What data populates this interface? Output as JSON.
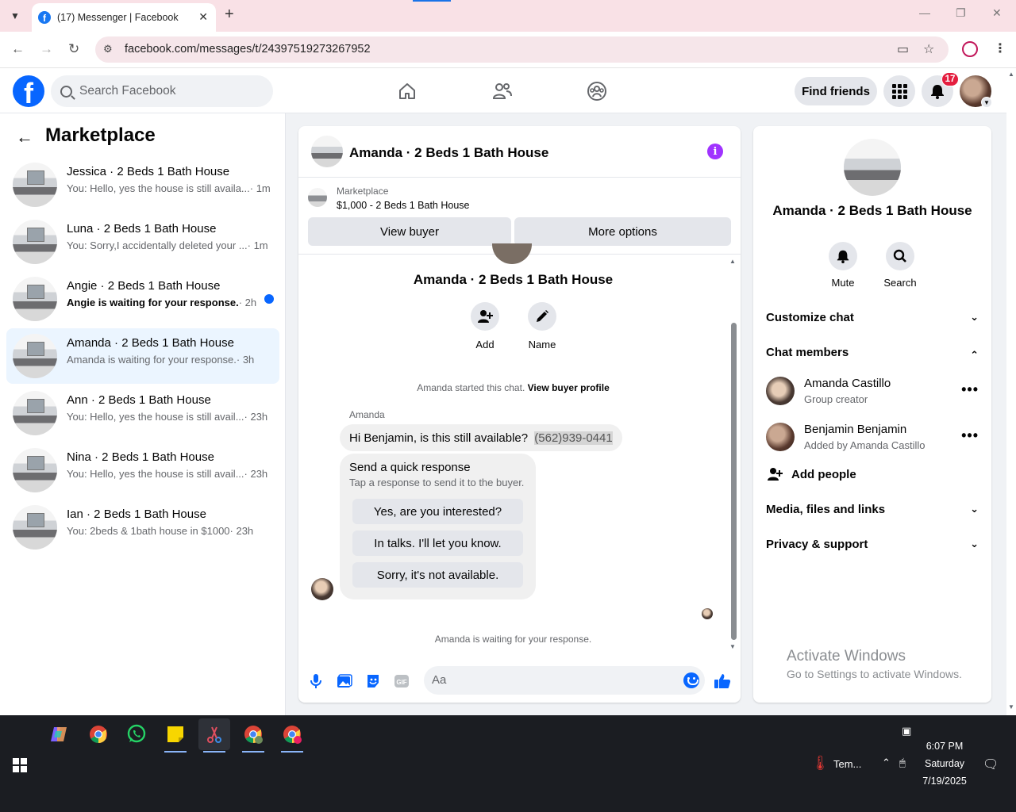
{
  "browser": {
    "tab_title": "(17) Messenger | Facebook",
    "url": "facebook.com/messages/t/24397519273267952"
  },
  "header": {
    "search_placeholder": "Search Facebook",
    "find_friends": "Find friends",
    "notification_count": "17"
  },
  "left_panel": {
    "title": "Marketplace",
    "conversations": [
      {
        "name": "Jessica · 2 Beds 1 Bath House",
        "preview": "You: Hello, yes the house is still availa...",
        "time": "· 1m",
        "unread": false,
        "active": false
      },
      {
        "name": "Luna · 2 Beds 1 Bath House",
        "preview": "You: Sorry,I accidentally deleted your ...",
        "time": "· 1m",
        "unread": false,
        "active": false
      },
      {
        "name": "Angie · 2 Beds 1 Bath House",
        "preview": "Angie is waiting for your response.",
        "time": "· 2h",
        "unread": true,
        "active": false
      },
      {
        "name": "Amanda · 2 Beds 1 Bath House",
        "preview": "Amanda is waiting for your response.",
        "time": "· 3h",
        "unread": false,
        "active": true
      },
      {
        "name": "Ann · 2 Beds 1 Bath House",
        "preview": "You: Hello, yes the house is still avail...",
        "time": "· 23h",
        "unread": false,
        "active": false
      },
      {
        "name": "Nina · 2 Beds 1 Bath House",
        "preview": "You: Hello, yes the house is still avail...",
        "time": "· 23h",
        "unread": false,
        "active": false
      },
      {
        "name": "Ian · 2 Beds 1 Bath House",
        "preview": "You: 2beds & 1bath house in $1000",
        "time": "· 23h",
        "unread": false,
        "active": false
      }
    ]
  },
  "chat": {
    "title": "Amanda · 2 Beds 1 Bath House",
    "marketplace_label": "Marketplace",
    "listing": "$1,000 - 2 Beds 1 Bath House",
    "view_buyer": "View buyer",
    "more_options": "More options",
    "intro_title": "Amanda · 2 Beds 1 Bath House",
    "add_label": "Add",
    "name_label": "Name",
    "started_text": "Amanda started this chat.",
    "view_buyer_profile": "View buyer profile",
    "sender": "Amanda",
    "message": "Hi Benjamin, is this still available?",
    "phone": "(562)939-0441",
    "quick_title": "Send a quick response",
    "quick_sub": "Tap a response to send it to the buyer.",
    "quick_responses": [
      "Yes, are you interested?",
      "In talks. I'll let you know.",
      "Sorry, it's not available."
    ],
    "waiting_text": "Amanda is waiting for your response.",
    "composer_placeholder": "Aa"
  },
  "right_panel": {
    "title": "Amanda · 2 Beds 1 Bath House",
    "mute": "Mute",
    "search": "Search",
    "customize_chat": "Customize chat",
    "chat_members": "Chat members",
    "members": [
      {
        "name": "Amanda Castillo",
        "sub": "Group creator"
      },
      {
        "name": "Benjamin Benjamin",
        "sub": "Added by Amanda Castillo"
      }
    ],
    "add_people": "Add people",
    "media": "Media, files and links",
    "privacy": "Privacy & support",
    "activate_title": "Activate Windows",
    "activate_sub": "Go to Settings to activate Windows."
  },
  "taskbar": {
    "weather": "Tem...",
    "time": "6:07 PM",
    "day": "Saturday",
    "date": "7/19/2025"
  },
  "colors": {
    "fb_blue": "#0866ff",
    "active_conversation": "#ebf5ff",
    "info_purple": "#a033ff",
    "notification_red": "#e41e3f"
  }
}
